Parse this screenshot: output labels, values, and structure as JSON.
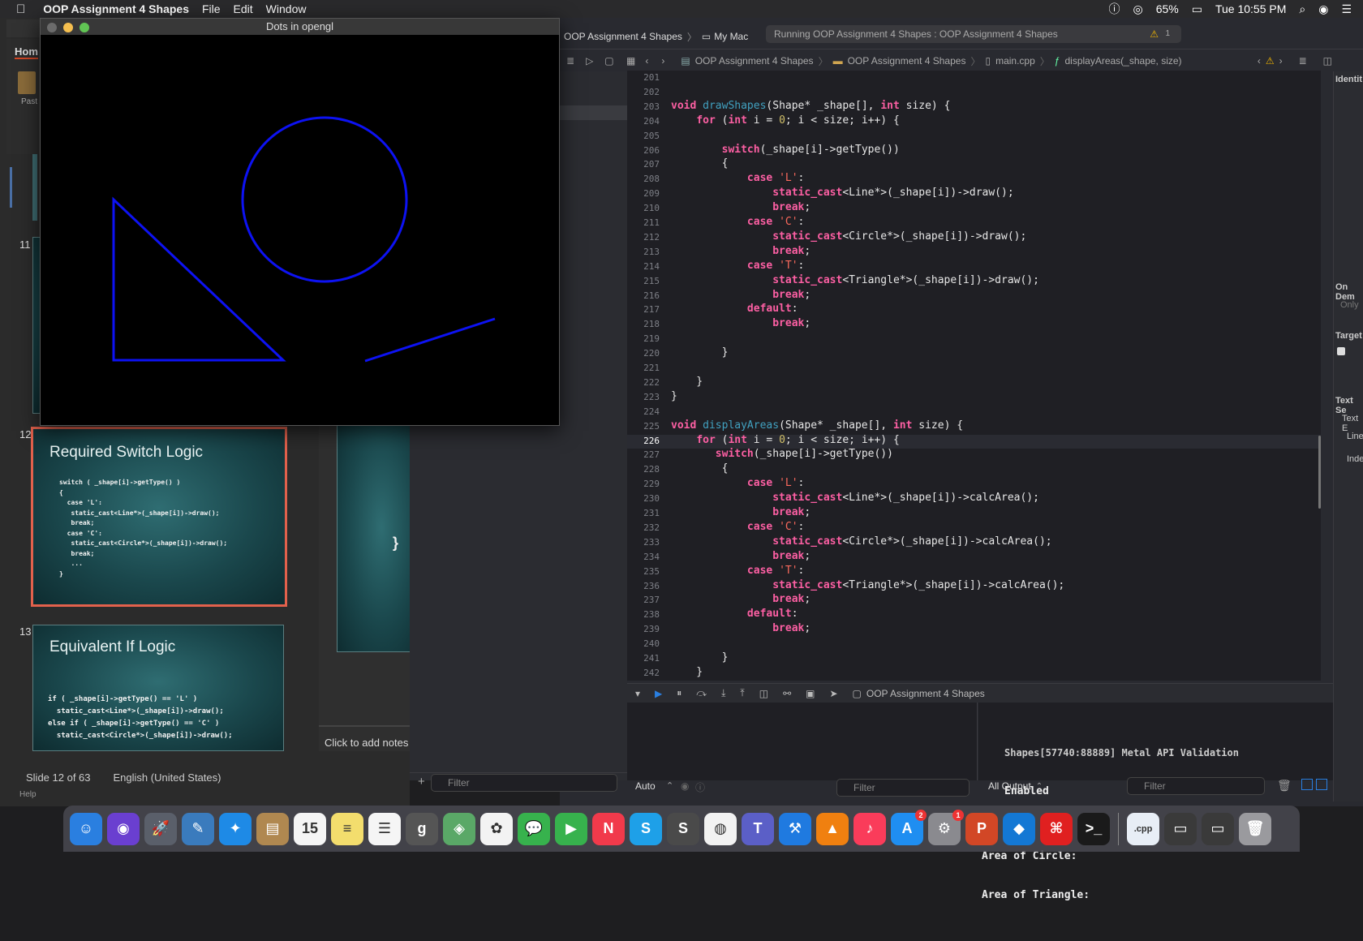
{
  "menubar": {
    "apple": "",
    "app_name": "OOP Assignment 4 Shapes",
    "items": [
      "File",
      "Edit",
      "Window"
    ],
    "battery": "65%",
    "clock": "Tue 10:55 PM"
  },
  "opengl_window": {
    "title": "Dots in opengl"
  },
  "powerpoint": {
    "ribbon_tab": "Hom",
    "paste_label": "Past",
    "slides": [
      {
        "number": "11"
      },
      {
        "number": "12",
        "title": "Required Switch Logic",
        "code": "switch ( _shape[i]->getType() )\n{\n  case 'L':\n   static_cast<Line*>(_shape[i])->draw();\n   break;\n  case 'C':\n   static_cast<Circle*>(_shape[i])->draw();\n   break;\n   ...\n}"
      },
      {
        "number": "13",
        "title": "Equivalent If Logic",
        "code": "if ( _shape[i]->getType() == 'L' )\n  static_cast<Line*>(_shape[i])->draw();\nelse if ( _shape[i]->getType() == 'C' )\n  static_cast<Circle*>(_shape[i])->draw();"
      }
    ],
    "main_slide_brace": "}",
    "notes_placeholder": "Click to add notes",
    "status_slide": "Slide 12 of 63",
    "status_lang": "English (United States)",
    "help": "Help"
  },
  "xcode": {
    "scheme": "OOP Assignment 4 Shapes",
    "destination": "My Mac",
    "status": "Running OOP Assignment 4 Shapes : OOP Assignment 4 Shapes",
    "warning_count": "1",
    "breadcrumb": [
      "OOP Assignment 4 Shapes",
      "OOP Assignment 4 Shapes",
      "main.cpp",
      "displayAreas(_shape, size)"
    ],
    "inspector": [
      "Identit",
      "On Dem",
      "Only",
      "Target",
      "Text Se",
      "Text E",
      "Line",
      "Inde"
    ],
    "debug_target": "OOP Assignment 4 Shapes",
    "vars_scope": "Auto",
    "output_scope": "All Output",
    "filter_placeholder": "Filter",
    "console_lines": [
      "Shapes[57740:88889] Metal API Validation",
      "Enabled",
      "",
      "Area of Circle:",
      "Area of Triangle:"
    ]
  },
  "code_lines": [
    {
      "n": "201",
      "html": ""
    },
    {
      "n": "202",
      "html": ""
    },
    {
      "n": "203",
      "html": "<span class='kw'>void</span> <span class='fd'>drawShapes</span>(Shape* _shape[], <span class='kw'>int</span> size) {"
    },
    {
      "n": "204",
      "html": "    <span class='kw'>for</span> (<span class='kw'>int</span> i = <span class='num'>0</span>; i &lt; size; i++) {"
    },
    {
      "n": "205",
      "html": ""
    },
    {
      "n": "206",
      "html": "        <span class='kw'>switch</span>(_shape[i]-&gt;getType())"
    },
    {
      "n": "207",
      "html": "        {"
    },
    {
      "n": "208",
      "html": "            <span class='kw'>case</span> <span class='str'>'L'</span>:"
    },
    {
      "n": "209",
      "html": "                <span class='kw'>static_cast</span>&lt;Line*&gt;(_shape[i])-&gt;draw();"
    },
    {
      "n": "210",
      "html": "                <span class='kw'>break</span>;"
    },
    {
      "n": "211",
      "html": "            <span class='kw'>case</span> <span class='str'>'C'</span>:"
    },
    {
      "n": "212",
      "html": "                <span class='kw'>static_cast</span>&lt;Circle*&gt;(_shape[i])-&gt;draw();"
    },
    {
      "n": "213",
      "html": "                <span class='kw'>break</span>;"
    },
    {
      "n": "214",
      "html": "            <span class='kw'>case</span> <span class='str'>'T'</span>:"
    },
    {
      "n": "215",
      "html": "                <span class='kw'>static_cast</span>&lt;Triangle*&gt;(_shape[i])-&gt;draw();"
    },
    {
      "n": "216",
      "html": "                <span class='kw'>break</span>;"
    },
    {
      "n": "217",
      "html": "            <span class='kw'>default</span>:"
    },
    {
      "n": "218",
      "html": "                <span class='kw'>break</span>;"
    },
    {
      "n": "219",
      "html": ""
    },
    {
      "n": "220",
      "html": "        }"
    },
    {
      "n": "221",
      "html": ""
    },
    {
      "n": "222",
      "html": "    }"
    },
    {
      "n": "223",
      "html": "}"
    },
    {
      "n": "224",
      "html": ""
    },
    {
      "n": "225",
      "html": "<span class='kw'>void</span> <span class='fd'>displayAreas</span>(Shape* _shape[], <span class='kw'>int</span> size) {"
    },
    {
      "n": "226",
      "html": "    <span class='kw'>for</span> (<span class='kw'>int</span> i = <span class='num'>0</span>; i &lt; size; i++) {"
    },
    {
      "n": "227",
      "html": "       <span class='kw'>switch</span>(_shape[i]-&gt;getType())"
    },
    {
      "n": "228",
      "html": "        {"
    },
    {
      "n": "229",
      "html": "            <span class='kw'>case</span> <span class='str'>'L'</span>:"
    },
    {
      "n": "230",
      "html": "                <span class='kw'>static_cast</span>&lt;Line*&gt;(_shape[i])-&gt;calcArea();"
    },
    {
      "n": "231",
      "html": "                <span class='kw'>break</span>;"
    },
    {
      "n": "232",
      "html": "            <span class='kw'>case</span> <span class='str'>'C'</span>:"
    },
    {
      "n": "233",
      "html": "                <span class='kw'>static_cast</span>&lt;Circle*&gt;(_shape[i])-&gt;calcArea();"
    },
    {
      "n": "234",
      "html": "                <span class='kw'>break</span>;"
    },
    {
      "n": "235",
      "html": "            <span class='kw'>case</span> <span class='str'>'T'</span>:"
    },
    {
      "n": "236",
      "html": "                <span class='kw'>static_cast</span>&lt;Triangle*&gt;(_shape[i])-&gt;calcArea();"
    },
    {
      "n": "237",
      "html": "                <span class='kw'>break</span>;"
    },
    {
      "n": "238",
      "html": "            <span class='kw'>default</span>:"
    },
    {
      "n": "239",
      "html": "                <span class='kw'>break</span>;"
    },
    {
      "n": "240",
      "html": ""
    },
    {
      "n": "241",
      "html": "        }"
    },
    {
      "n": "242",
      "html": "    }"
    }
  ],
  "dock": [
    {
      "name": "finder-icon",
      "glyph": "☺",
      "color": "#2a7fe0"
    },
    {
      "name": "siri-icon",
      "glyph": "◉",
      "color": "#6a3fd0"
    },
    {
      "name": "launchpad-icon",
      "glyph": "🚀",
      "color": "#5a5f6a"
    },
    {
      "name": "preview-icon",
      "glyph": "✎",
      "color": "#3a7bbd"
    },
    {
      "name": "safari-icon",
      "glyph": "✦",
      "color": "#1e8ae6"
    },
    {
      "name": "notebook-icon",
      "glyph": "▤",
      "color": "#b08850"
    },
    {
      "name": "calendar-icon",
      "glyph": "15",
      "color": "#f5f5f5"
    },
    {
      "name": "notes-icon",
      "glyph": "≡",
      "color": "#f3dd6d"
    },
    {
      "name": "reminders-icon",
      "glyph": "☰",
      "color": "#f5f5f5"
    },
    {
      "name": "grammarly-icon",
      "glyph": "g",
      "color": "#555"
    },
    {
      "name": "maps-icon",
      "glyph": "◈",
      "color": "#5aa867"
    },
    {
      "name": "photos-icon",
      "glyph": "✿",
      "color": "#f3f3f3"
    },
    {
      "name": "messages-icon",
      "glyph": "💬",
      "color": "#37b24d"
    },
    {
      "name": "facetime-icon",
      "glyph": "▶",
      "color": "#37b24d"
    },
    {
      "name": "news-icon",
      "glyph": "N",
      "color": "#f13a4b"
    },
    {
      "name": "skype-icon",
      "glyph": "S",
      "color": "#1ea0e8"
    },
    {
      "name": "sublime-icon",
      "glyph": "S",
      "color": "#4a4a4a"
    },
    {
      "name": "chrome-icon",
      "glyph": "◍",
      "color": "#f2f2f2"
    },
    {
      "name": "teams-icon",
      "glyph": "T",
      "color": "#5b5fc7"
    },
    {
      "name": "xcode-icon",
      "glyph": "⚒",
      "color": "#1f7ae0"
    },
    {
      "name": "vlc-icon",
      "glyph": "▲",
      "color": "#f08010"
    },
    {
      "name": "music-icon",
      "glyph": "♪",
      "color": "#fa3c5a"
    },
    {
      "name": "appstore-icon",
      "glyph": "A",
      "color": "#1f8ef1",
      "badge": "2"
    },
    {
      "name": "settings-icon",
      "glyph": "⚙",
      "color": "#8a8a8f",
      "badge": "1"
    },
    {
      "name": "powerpoint-icon",
      "glyph": "P",
      "color": "#d24726"
    },
    {
      "name": "vpn-icon",
      "glyph": "◆",
      "color": "#1478d4"
    },
    {
      "name": "acrobat-icon",
      "glyph": "⌘",
      "color": "#e02020"
    },
    {
      "name": "terminal-icon",
      "glyph": ">_",
      "color": "#1a1a1a"
    },
    {
      "name": "cpp-file-icon",
      "glyph": ".cpp",
      "color": "#e8eef6"
    },
    {
      "name": "screenshot1-icon",
      "glyph": "▭",
      "color": "#3a3a3a"
    },
    {
      "name": "screenshot2-icon",
      "glyph": "▭",
      "color": "#3a3a3a"
    },
    {
      "name": "trash-icon",
      "glyph": "🗑",
      "color": "#9a9a9e"
    }
  ],
  "colors": {
    "shape_stroke": "#0d12f2",
    "selected_slide_border": "#e2614c"
  }
}
